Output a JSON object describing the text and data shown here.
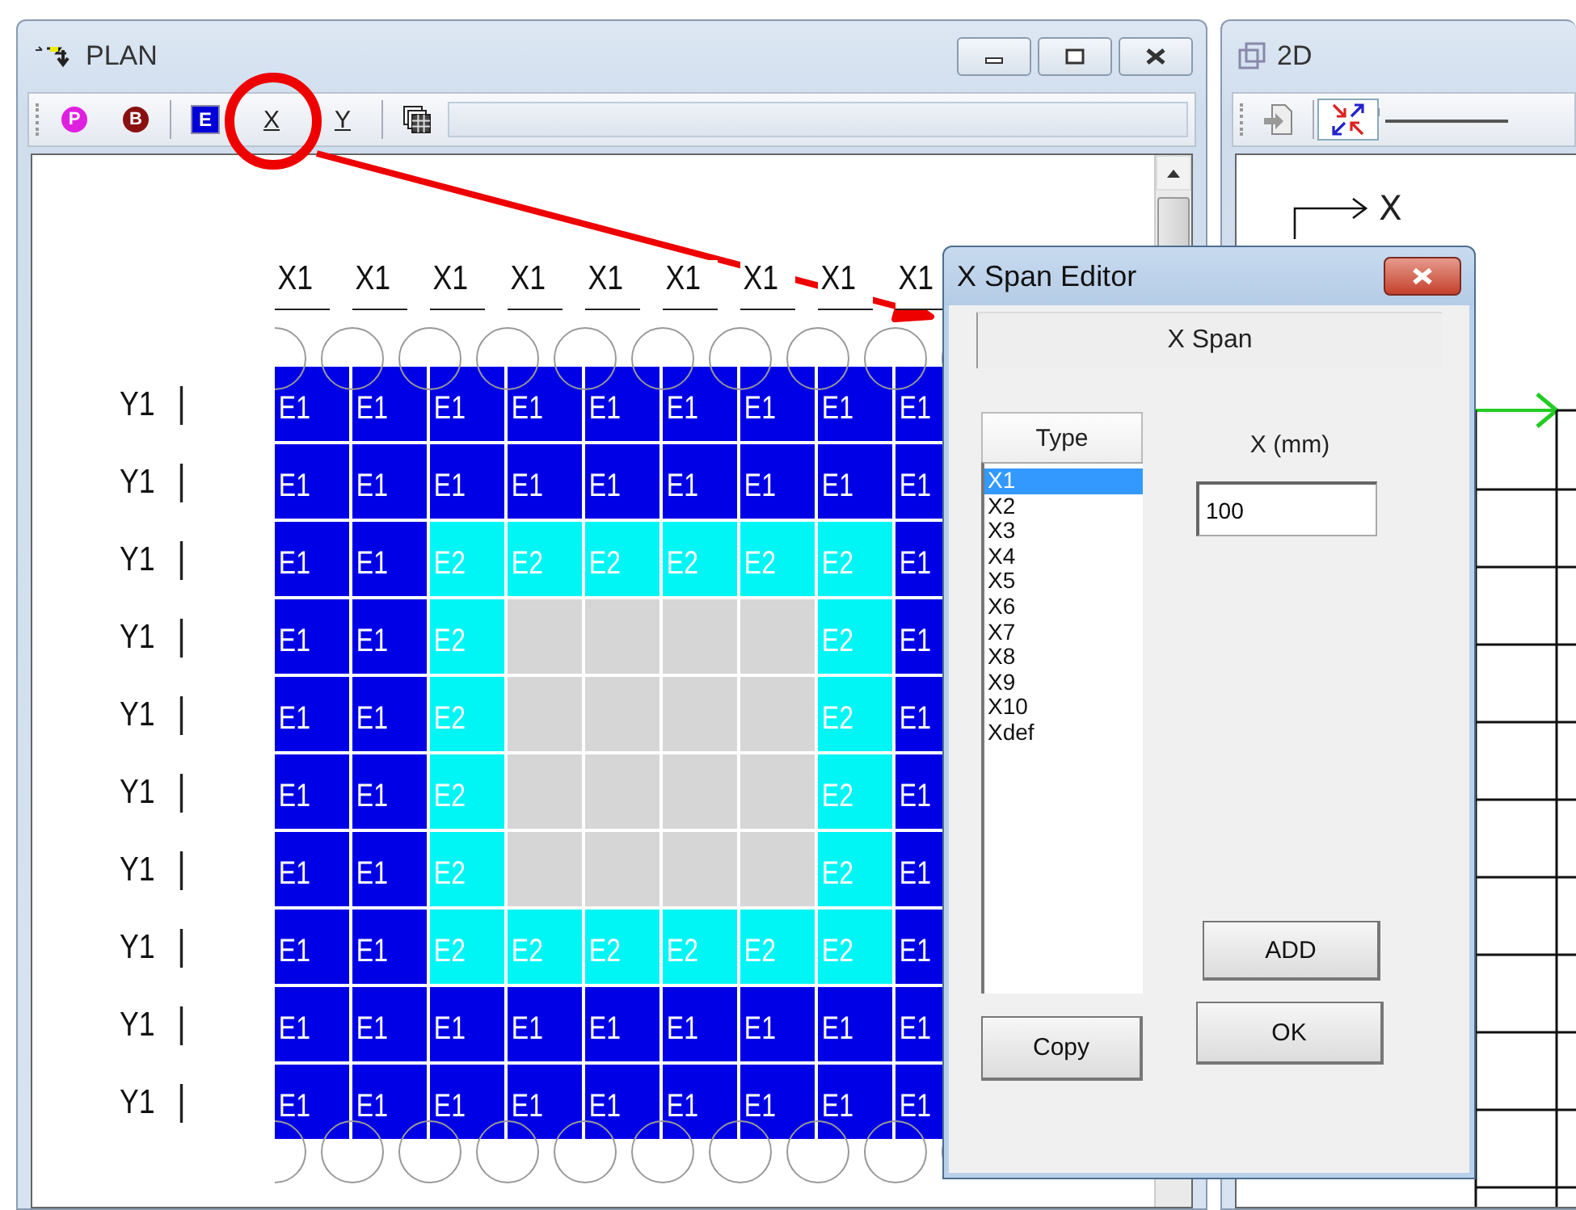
{
  "plan_window": {
    "title": "PLAN",
    "toolbar": [
      {
        "kind": "p",
        "label": "P"
      },
      {
        "kind": "b",
        "label": "B"
      },
      {
        "kind": "e",
        "label": "E"
      },
      {
        "kind": "axis",
        "label": "X"
      },
      {
        "kind": "axis",
        "label": "Y"
      },
      {
        "kind": "grid"
      }
    ],
    "column_labels": [
      "X1",
      "X1",
      "X1",
      "X1",
      "X1",
      "X1",
      "X1",
      "X1",
      "X1"
    ],
    "rows": [
      {
        "label": "Y1",
        "cells": [
          {
            "label": "E1",
            "kind": "e1"
          },
          {
            "label": "E1",
            "kind": "e1"
          },
          {
            "label": "E1",
            "kind": "e1"
          },
          {
            "label": "E1",
            "kind": "e1"
          },
          {
            "label": "E1",
            "kind": "e1"
          },
          {
            "label": "E1",
            "kind": "e1"
          },
          {
            "label": "E1",
            "kind": "e1"
          },
          {
            "label": "E1",
            "kind": "e1"
          },
          {
            "label": "E1",
            "kind": "e1"
          }
        ]
      },
      {
        "label": "Y1",
        "cells": [
          {
            "label": "E1",
            "kind": "e1"
          },
          {
            "label": "E1",
            "kind": "e1"
          },
          {
            "label": "E1",
            "kind": "e1"
          },
          {
            "label": "E1",
            "kind": "e1"
          },
          {
            "label": "E1",
            "kind": "e1"
          },
          {
            "label": "E1",
            "kind": "e1"
          },
          {
            "label": "E1",
            "kind": "e1"
          },
          {
            "label": "E1",
            "kind": "e1"
          },
          {
            "label": "E1",
            "kind": "e1"
          }
        ]
      },
      {
        "label": "Y1",
        "cells": [
          {
            "label": "E1",
            "kind": "e1"
          },
          {
            "label": "E1",
            "kind": "e1"
          },
          {
            "label": "E2",
            "kind": "e2"
          },
          {
            "label": "E2",
            "kind": "e2"
          },
          {
            "label": "E2",
            "kind": "e2"
          },
          {
            "label": "E2",
            "kind": "e2"
          },
          {
            "label": "E2",
            "kind": "e2"
          },
          {
            "label": "E2",
            "kind": "e2"
          },
          {
            "label": "E1",
            "kind": "e1"
          }
        ]
      },
      {
        "label": "Y1",
        "cells": [
          {
            "label": "E1",
            "kind": "e1"
          },
          {
            "label": "E1",
            "kind": "e1"
          },
          {
            "label": "E2",
            "kind": "e2"
          },
          {
            "kind": "empty"
          },
          {
            "kind": "empty"
          },
          {
            "kind": "empty"
          },
          {
            "kind": "empty"
          },
          {
            "label": "E2",
            "kind": "e2"
          },
          {
            "label": "E1",
            "kind": "e1"
          }
        ]
      },
      {
        "label": "Y1",
        "cells": [
          {
            "label": "E1",
            "kind": "e1"
          },
          {
            "label": "E1",
            "kind": "e1"
          },
          {
            "label": "E2",
            "kind": "e2"
          },
          {
            "kind": "empty"
          },
          {
            "kind": "empty"
          },
          {
            "kind": "empty"
          },
          {
            "kind": "empty"
          },
          {
            "label": "E2",
            "kind": "e2"
          },
          {
            "label": "E1",
            "kind": "e1"
          }
        ]
      },
      {
        "label": "Y1",
        "cells": [
          {
            "label": "E1",
            "kind": "e1"
          },
          {
            "label": "E1",
            "kind": "e1"
          },
          {
            "label": "E2",
            "kind": "e2"
          },
          {
            "kind": "empty"
          },
          {
            "kind": "empty"
          },
          {
            "kind": "empty"
          },
          {
            "kind": "empty"
          },
          {
            "label": "E2",
            "kind": "e2"
          },
          {
            "label": "E1",
            "kind": "e1"
          }
        ]
      },
      {
        "label": "Y1",
        "cells": [
          {
            "label": "E1",
            "kind": "e1"
          },
          {
            "label": "E1",
            "kind": "e1"
          },
          {
            "label": "E2",
            "kind": "e2"
          },
          {
            "kind": "empty"
          },
          {
            "kind": "empty"
          },
          {
            "kind": "empty"
          },
          {
            "kind": "empty"
          },
          {
            "label": "E2",
            "kind": "e2"
          },
          {
            "label": "E1",
            "kind": "e1"
          }
        ]
      },
      {
        "label": "Y1",
        "cells": [
          {
            "label": "E1",
            "kind": "e1"
          },
          {
            "label": "E1",
            "kind": "e1"
          },
          {
            "label": "E2",
            "kind": "e2"
          },
          {
            "label": "E2",
            "kind": "e2"
          },
          {
            "label": "E2",
            "kind": "e2"
          },
          {
            "label": "E2",
            "kind": "e2"
          },
          {
            "label": "E2",
            "kind": "e2"
          },
          {
            "label": "E2",
            "kind": "e2"
          },
          {
            "label": "E1",
            "kind": "e1"
          }
        ]
      },
      {
        "label": "Y1",
        "cells": [
          {
            "label": "E1",
            "kind": "e1"
          },
          {
            "label": "E1",
            "kind": "e1"
          },
          {
            "label": "E1",
            "kind": "e1"
          },
          {
            "label": "E1",
            "kind": "e1"
          },
          {
            "label": "E1",
            "kind": "e1"
          },
          {
            "label": "E1",
            "kind": "e1"
          },
          {
            "label": "E1",
            "kind": "e1"
          },
          {
            "label": "E1",
            "kind": "e1"
          },
          {
            "label": "E1",
            "kind": "e1"
          }
        ]
      },
      {
        "label": "Y1",
        "cells": [
          {
            "label": "E1",
            "kind": "e1"
          },
          {
            "label": "E1",
            "kind": "e1"
          },
          {
            "label": "E1",
            "kind": "e1"
          },
          {
            "label": "E1",
            "kind": "e1"
          },
          {
            "label": "E1",
            "kind": "e1"
          },
          {
            "label": "E1",
            "kind": "e1"
          },
          {
            "label": "E1",
            "kind": "e1"
          },
          {
            "label": "E1",
            "kind": "e1"
          },
          {
            "label": "E1",
            "kind": "e1"
          }
        ]
      }
    ]
  },
  "view_2d_window": {
    "title": "2D",
    "axis_label": "X"
  },
  "dialog": {
    "title": "X Span Editor",
    "header": "X Span",
    "list_header": "Type",
    "types": [
      {
        "label": "X1",
        "selected": true
      },
      {
        "label": "X2",
        "selected": false
      },
      {
        "label": "X3",
        "selected": false
      },
      {
        "label": "X4",
        "selected": false
      },
      {
        "label": "X5",
        "selected": false
      },
      {
        "label": "X6",
        "selected": false
      },
      {
        "label": "X7",
        "selected": false
      },
      {
        "label": "X8",
        "selected": false
      },
      {
        "label": "X9",
        "selected": false
      },
      {
        "label": "X10",
        "selected": false
      },
      {
        "label": "Xdef",
        "selected": false
      }
    ],
    "field_label": "X (mm)",
    "field_value": "100",
    "buttons": {
      "add": "ADD",
      "copy": "Copy",
      "ok": "OK"
    }
  }
}
